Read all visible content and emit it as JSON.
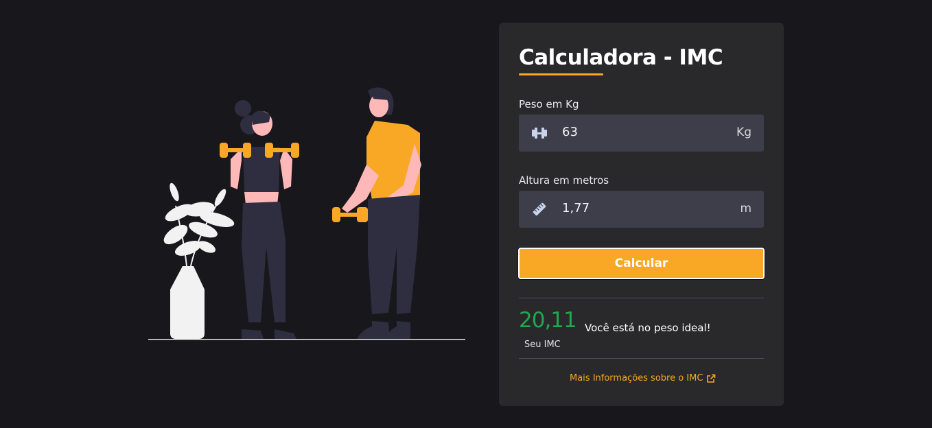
{
  "calculator": {
    "title": "Calculadora - IMC",
    "weight": {
      "label": "Peso em Kg",
      "value": "63",
      "unit": "Kg",
      "icon": "dumbbell-icon"
    },
    "height": {
      "label": "Altura em metros",
      "value": "1,77",
      "unit": "m",
      "icon": "ruler-icon"
    },
    "button_label": "Calcular",
    "result": {
      "value": "20,11",
      "caption": "Seu IMC",
      "message": "Você está no peso ideal!"
    },
    "more_info_label": "Mais Informações sobre o IMC",
    "more_info_icon": "external-link-icon"
  },
  "colors": {
    "accent": "#f9a826",
    "result_green": "#23a64e",
    "background": "#18171c",
    "card": "#29292b",
    "input": "#3e3e4a"
  }
}
